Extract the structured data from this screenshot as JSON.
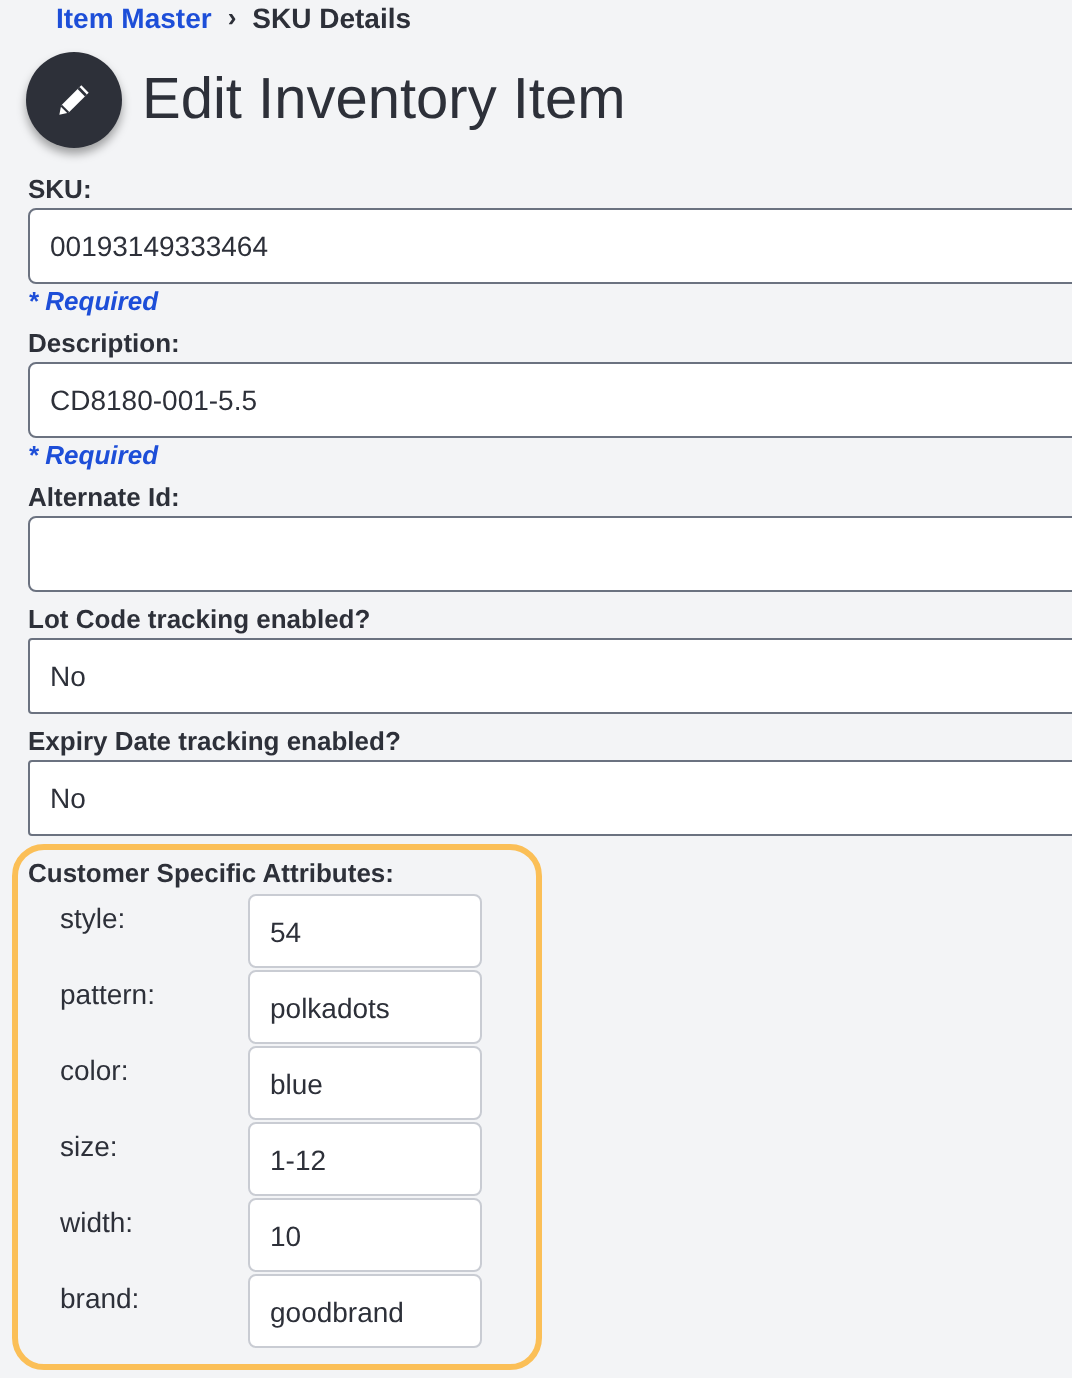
{
  "breadcrumb": {
    "link": "Item Master",
    "separator": "›",
    "current": "SKU Details"
  },
  "title": "Edit Inventory Item",
  "fields": [
    {
      "label": "SKU:",
      "kind": "text",
      "value": "00193149333464",
      "required": "* Required"
    },
    {
      "label": "Description:",
      "kind": "text",
      "value": "CD8180-001-5.5",
      "required": "* Required"
    },
    {
      "label": "Alternate Id:",
      "kind": "text"
    },
    {
      "label": "Lot Code tracking enabled?",
      "kind": "select",
      "value": "No"
    },
    {
      "label": "Expiry Date tracking enabled?",
      "kind": "select",
      "value": "No"
    }
  ],
  "attributes": {
    "heading": "Customer Specific Attributes:",
    "items": [
      {
        "label": "style:",
        "value": "54"
      },
      {
        "label": "pattern:",
        "value": "polkadots"
      },
      {
        "label": "color:",
        "value": "blue"
      },
      {
        "label": "size:",
        "value": "1-12"
      },
      {
        "label": "width:",
        "value": "10"
      },
      {
        "label": "brand:",
        "value": "goodbrand"
      }
    ]
  }
}
